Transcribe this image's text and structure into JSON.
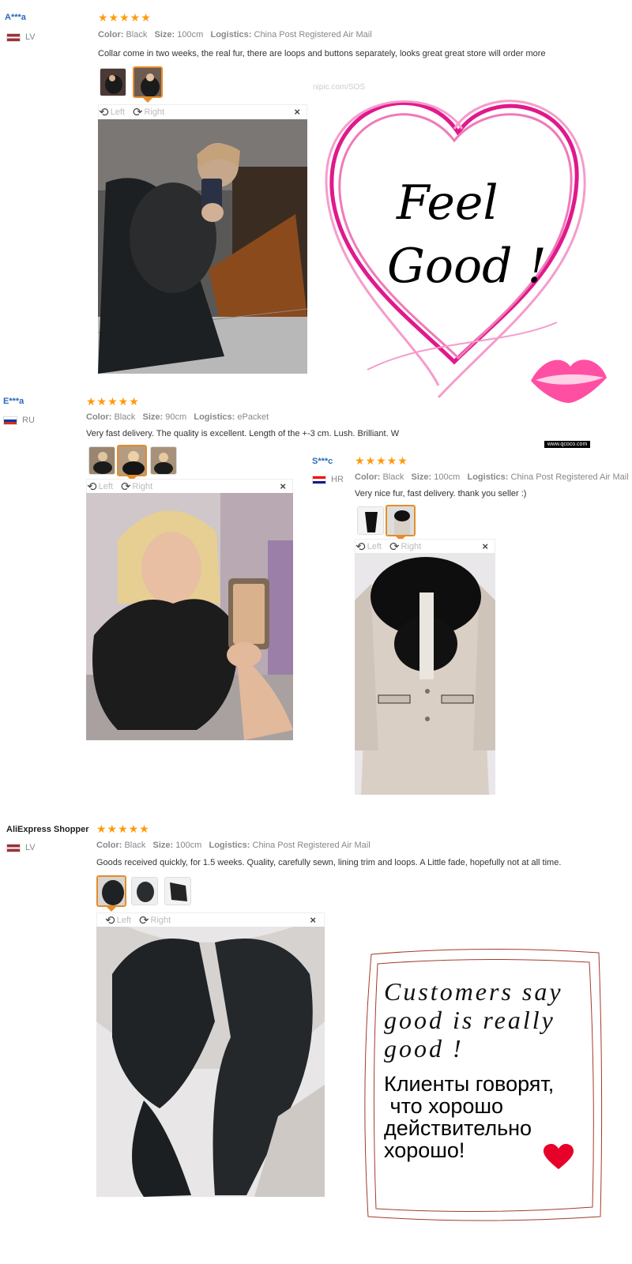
{
  "reviews": [
    {
      "user": "A***a",
      "country": "LV",
      "stars": "★★★★★",
      "color_label": "Color:",
      "color": "Black",
      "size_label": "Size:",
      "size": "100cm",
      "logistics_label": "Logistics:",
      "logistics": "China Post Registered Air Mail",
      "text": "Collar come in two weeks, the real fur, there are loops and buttons separately, looks great great store will order more",
      "rotate_left": "Left",
      "rotate_right": "Right",
      "close": "×"
    },
    {
      "user": "E***a",
      "country": "RU",
      "stars": "★★★★★",
      "color_label": "Color:",
      "color": "Black",
      "size_label": "Size:",
      "size": "90cm",
      "logistics_label": "Logistics:",
      "logistics": "ePacket",
      "text": "Very fast delivery. The quality is excellent. Length of the +-3 cm. Lush. Brilliant. W",
      "rotate_left": "Left",
      "rotate_right": "Right",
      "close": "×"
    },
    {
      "user": "S***c",
      "country": "HR",
      "stars": "★★★★★",
      "color_label": "Color:",
      "color": "Black",
      "size_label": "Size:",
      "size": "100cm",
      "logistics_label": "Logistics:",
      "logistics": "China Post Registered Air Mail",
      "text": "Very nice fur, fast delivery. thank you seller :)",
      "rotate_left": "Left",
      "rotate_right": "Right",
      "close": "×"
    },
    {
      "user": "AliExpress Shopper",
      "country": "LV",
      "stars": "★★★★★",
      "color_label": "Color:",
      "color": "Black",
      "size_label": "Size:",
      "size": "100cm",
      "logistics_label": "Logistics:",
      "logistics": "China Post Registered Air Mail",
      "text": "Goods received quickly, for 1.5 weeks. Quality, carefully sewn, lining trim and loops. A Little fade, hopefully not at all time.",
      "rotate_left": "Left",
      "rotate_right": "Right",
      "close": "×"
    }
  ],
  "watermark": "nipic.com/SOS",
  "watermark2": "www.qcoco.com",
  "feel_good": {
    "line1": "Feel",
    "line2": "Good !"
  },
  "customers_say": {
    "en1": "Customers say",
    "en2": "good is really",
    "en3": "good !",
    "ru1": "Клиенты говорят,",
    "ru2": " что хорошо",
    "ru3": "действительно",
    "ru4": "хорошо!"
  },
  "colors": {
    "star": "#ff9a0b",
    "username": "#2a6bb5",
    "heart": "#e0198c",
    "lips": "#ff4fa3",
    "selected_thumb": "#e38d2b"
  }
}
